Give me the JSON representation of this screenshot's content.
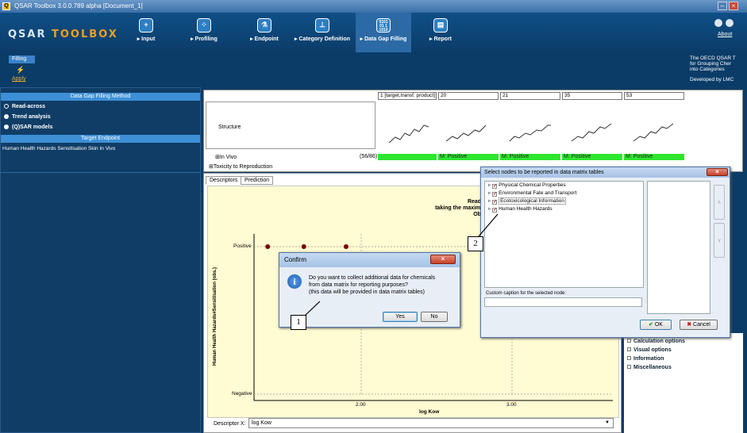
{
  "window": {
    "title": "QSAR Toolbox 3.0.0.789 alpha [Document_1]",
    "logo_a": "QSAR ",
    "logo_b": "TOOLBOX",
    "min": "–",
    "close": "×"
  },
  "ribbon": {
    "items": [
      {
        "label": "▸ Input",
        "icon": "plus-icon"
      },
      {
        "label": "▸ Profiling",
        "icon": "profiling-icon"
      },
      {
        "label": "▸ Endpoint",
        "icon": "flask-icon"
      },
      {
        "label": "▸ Category Definition",
        "icon": "hierarchy-icon"
      },
      {
        "label": "▸ Data Gap Filling",
        "icon": "binary-icon"
      },
      {
        "label": "▸ Report",
        "icon": "document-icon"
      }
    ],
    "about": "About"
  },
  "subtoolbar": {
    "tab": "Filling",
    "apply": "Apply",
    "info_lines": [
      "The OECD QSAR T",
      "for Grouping Cher",
      "into Categories"
    ],
    "developed": "Developed by LMC"
  },
  "left_panel": {
    "method_header": "Data Gap Filling Method",
    "methods": [
      "Read-across",
      "Trend analysis",
      "(Q)SAR models"
    ],
    "endpoint_header": "Target Endpoint",
    "endpoint": "Human Health Hazards Sensitisation Skin In Vivo"
  },
  "grid": {
    "columns": [
      "1 [target,transf. product]",
      "20",
      "21",
      "35",
      "53"
    ],
    "structure_label": "Structure",
    "in_vivo_label": "In Vivo",
    "in_vivo_count": "(56/86)",
    "tox_label": "Toxicity to Reproduction",
    "values": [
      "",
      "M: Positive",
      "M: Positive",
      "M: Positive",
      "M: Positive"
    ]
  },
  "plot_tabs": [
    "Descriptors",
    "Prediction"
  ],
  "plot": {
    "title1": "Read across prediction of Human Health Hazards#Sensit",
    "title2": "taking the maximal from the nearest 5 neighbours, based on 4 values",
    "title3": "Observed target value: N/A, Predicted target value: 'Po",
    "ylabel": "Human Health Hazards#Sensitisation (obs.)",
    "xlabel": "log Kow",
    "ytick_top": "Positive",
    "ytick_bottom": "Negative",
    "xtick1": "2.00",
    "xtick2": "3.00",
    "descriptor_label": "Descriptor X:",
    "descriptor_value": "log Kow"
  },
  "chart_data": {
    "type": "scatter",
    "xlabel": "log Kow",
    "ylabel": "Human Health Hazards#Sensitisation (obs.)",
    "categories": [
      "Negative",
      "Positive"
    ],
    "xticks": [
      2.0,
      3.0
    ],
    "points": [
      {
        "x": 1.38,
        "y": "Positive"
      },
      {
        "x": 1.62,
        "y": "Positive"
      },
      {
        "x": 1.9,
        "y": "Positive"
      }
    ]
  },
  "options": [
    "Calculation options",
    "Visual options",
    "Information",
    "Miscellaneous"
  ],
  "confirm": {
    "title": "Confirm",
    "line1": "Do you want to collect additional data for chemicals",
    "line2": "from data matrix for reporting purposes?",
    "line3": "(this data will be provided in data matrix tables)",
    "yes": "Yes",
    "no": "No"
  },
  "nodes_dialog": {
    "title": "Select nodes to be reported in data matrix tables",
    "nodes": [
      "Physical Chemical Properties",
      "Environmental Fate and Transport",
      "Ecotoxicological Information",
      "Human Health Hazards"
    ],
    "caption_label": "Custom caption for the selected node:",
    "ok": "OK",
    "cancel": "Cancel",
    "up": "∧",
    "down": "∨"
  },
  "callouts": [
    "1",
    "2"
  ]
}
